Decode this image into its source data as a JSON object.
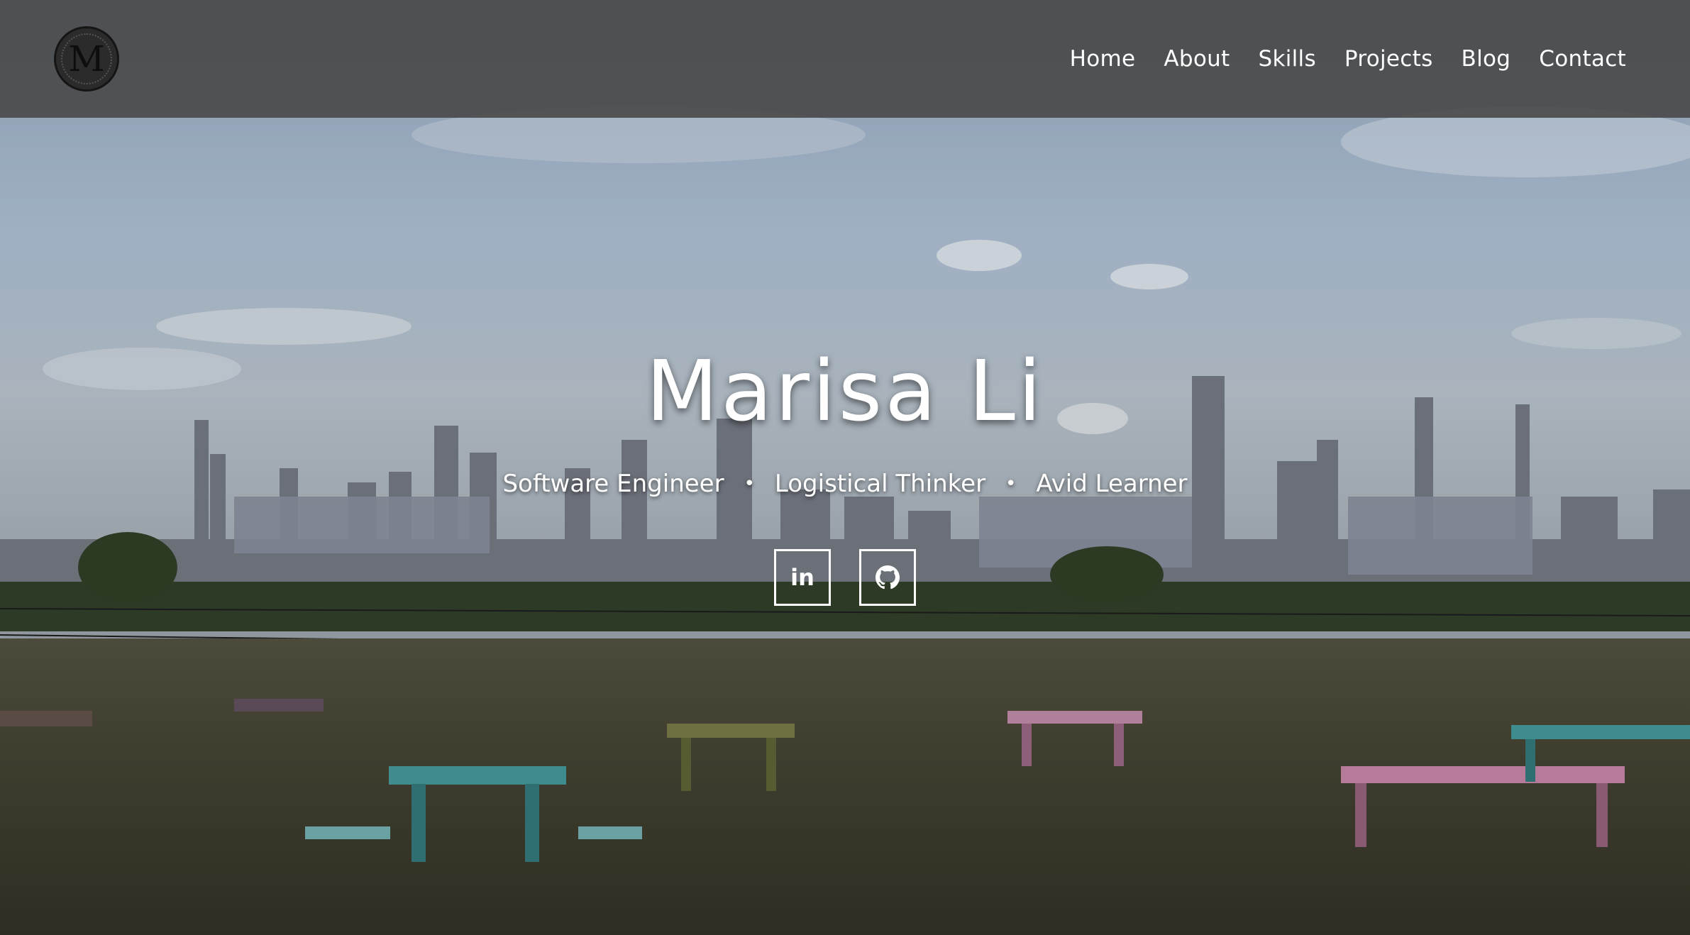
{
  "header": {
    "logo_letter": "M",
    "nav": [
      {
        "label": "Home"
      },
      {
        "label": "About"
      },
      {
        "label": "Skills"
      },
      {
        "label": "Projects"
      },
      {
        "label": "Blog"
      },
      {
        "label": "Contact"
      }
    ]
  },
  "hero": {
    "name": "Marisa Li",
    "taglines": [
      "Software Engineer",
      "Logistical Thinker",
      "Avid Learner"
    ],
    "separator": "•",
    "socials": [
      {
        "label": "in",
        "icon": "linkedin-icon"
      },
      {
        "icon": "github-icon"
      }
    ]
  },
  "colors": {
    "navbar": "#464646",
    "text": "#ffffff"
  }
}
